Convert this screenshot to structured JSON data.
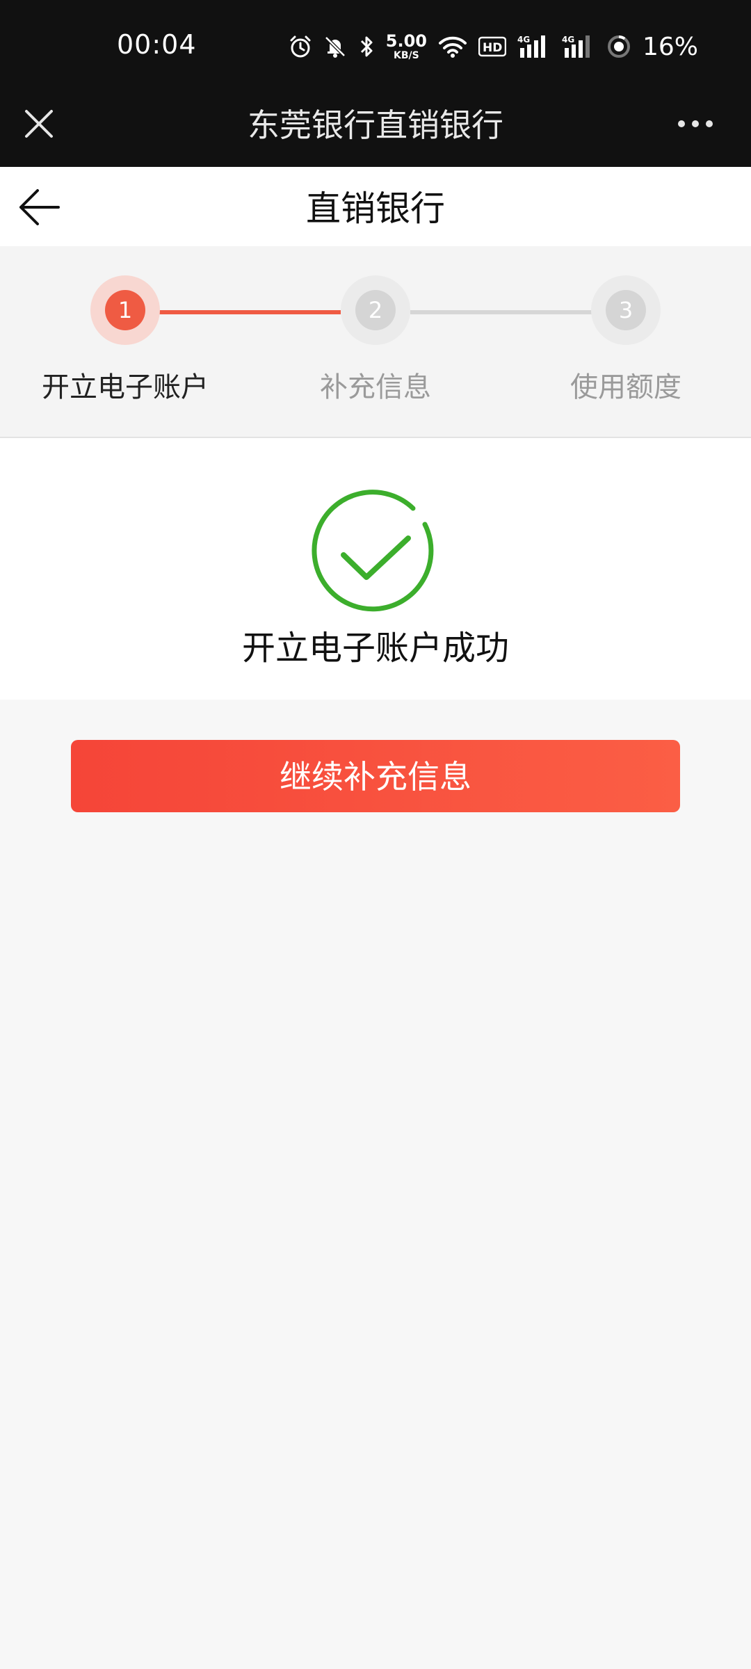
{
  "status_bar": {
    "time": "00:04",
    "net_speed_value": "5.00",
    "net_speed_unit": "KB/S",
    "battery": "16%",
    "icons": [
      "alarm-icon",
      "mute-bell-icon",
      "bluetooth-icon",
      "wifi-icon",
      "hd-icon",
      "signal-4g-icon",
      "signal-4g-icon",
      "battery-ring-icon"
    ]
  },
  "mini_program": {
    "title": "东莞银行直销银行",
    "close_icon": "close-icon",
    "more_icon": "more-dots-icon"
  },
  "page": {
    "title": "直销银行",
    "back_icon": "back-arrow-icon"
  },
  "steps": [
    {
      "number": "1",
      "label": "开立电子账户",
      "state": "active"
    },
    {
      "number": "2",
      "label": "补充信息",
      "state": "inactive"
    },
    {
      "number": "3",
      "label": "使用额度",
      "state": "inactive"
    }
  ],
  "success": {
    "icon": "check-circle-icon",
    "text": "开立电子账户成功"
  },
  "actions": {
    "continue_label": "继续补充信息"
  },
  "colors": {
    "accent": "#ef5b43",
    "success_green": "#3cae2c",
    "header_bg": "#111111"
  }
}
